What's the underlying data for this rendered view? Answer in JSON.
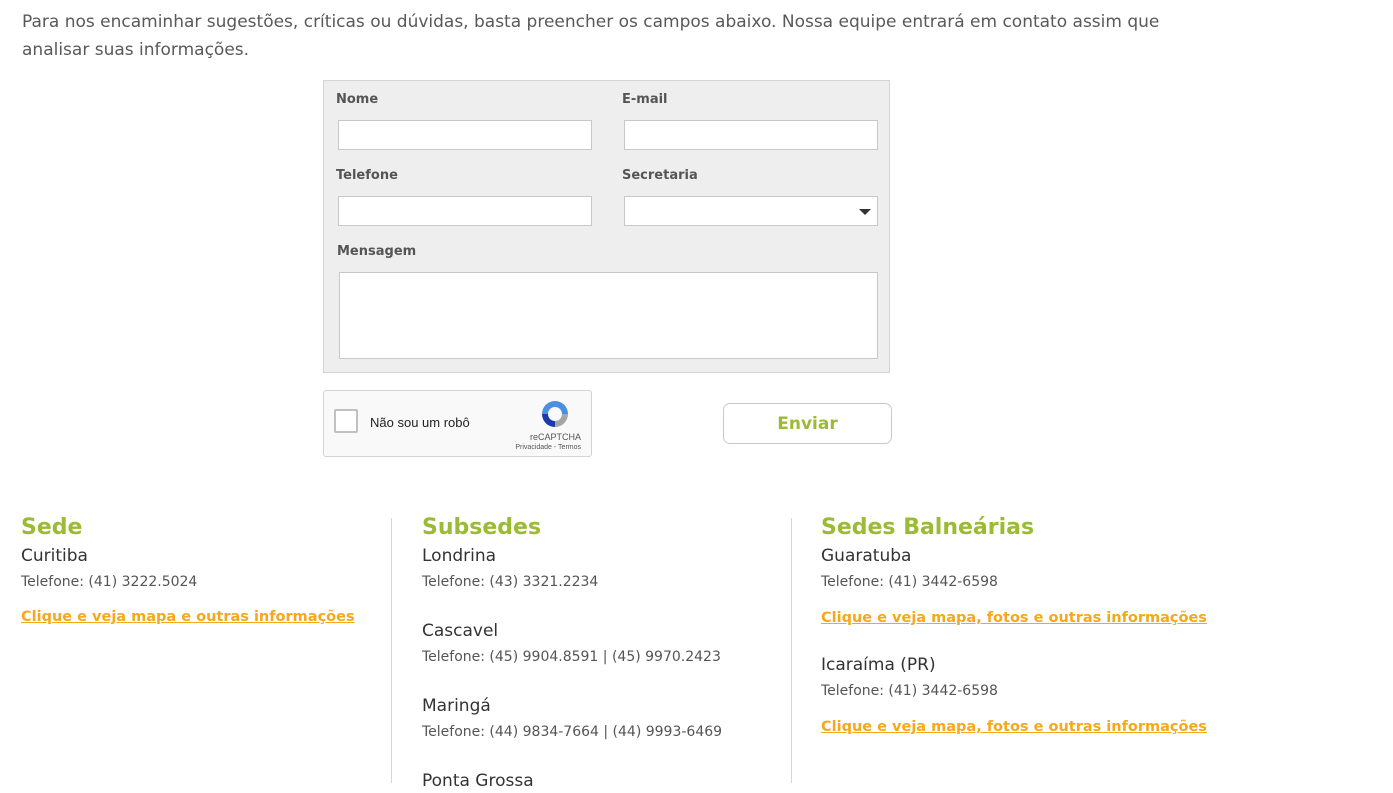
{
  "intro": "Para nos encaminhar sugestões, críticas ou dúvidas, basta preencher os campos abaixo. Nossa equipe entrará em contato assim que analisar suas informações.",
  "form": {
    "nome_label": "Nome",
    "email_label": "E-mail",
    "telefone_label": "Telefone",
    "secretaria_label": "Secretaria",
    "secretaria_value": "",
    "mensagem_label": "Mensagem"
  },
  "captcha": {
    "label": "Não sou um robô",
    "brand": "reCAPTCHA",
    "terms": "Privacidade - Termos"
  },
  "send_label": "Enviar",
  "sede": {
    "title": "Sede",
    "city": "Curitiba",
    "phone": "Telefone: (41) 3222.5024",
    "link": "Clique e veja mapa e outras informações"
  },
  "subsedes": {
    "title": "Subsedes",
    "items": [
      {
        "city": "Londrina",
        "phone": "Telefone: (43) 3321.2234"
      },
      {
        "city": "Cascavel",
        "phone": "Telefone: (45) 9904.8591 | (45) 9970.2423"
      },
      {
        "city": "Maringá",
        "phone": "Telefone: (44) 9834-7664 | (44) 9993-6469"
      },
      {
        "city": "Ponta Grossa"
      }
    ]
  },
  "balnearias": {
    "title": "Sedes Balneárias",
    "items": [
      {
        "city": "Guaratuba",
        "phone": "Telefone: (41) 3442-6598",
        "link": "Clique e veja mapa, fotos e outras informações"
      },
      {
        "city": "Icaraíma (PR)",
        "phone": "Telefone: (41) 3442-6598",
        "link": "Clique e veja mapa, fotos e outras informações"
      }
    ]
  },
  "colors": {
    "accent_green": "#9bbb35",
    "link_orange": "#f5a81c"
  }
}
